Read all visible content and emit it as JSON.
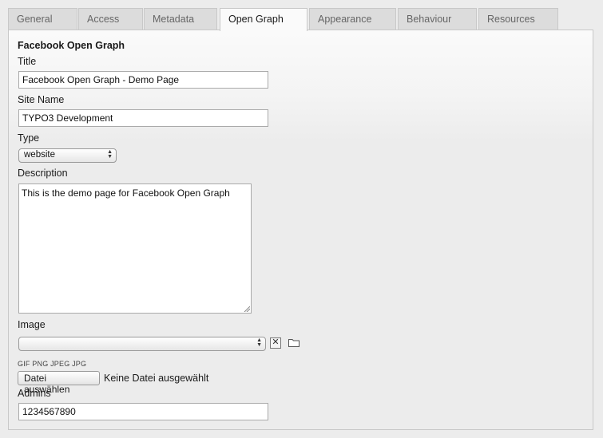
{
  "tabs": [
    "General",
    "Access",
    "Metadata",
    "Open Graph",
    "Appearance",
    "Behaviour",
    "Resources"
  ],
  "section_title": "Facebook Open Graph",
  "fields": {
    "title_label": "Title",
    "title_value": "Facebook Open Graph - Demo Page",
    "site_name_label": "Site Name",
    "site_name_value": "TYPO3 Development",
    "type_label": "Type",
    "type_value": "website",
    "description_label": "Description",
    "description_value": "This is the demo page for Facebook Open Graph",
    "image_label": "Image",
    "image_value": "",
    "file_types": "GIF PNG JPEG JPG",
    "choose_file_label": "Datei auswählen",
    "no_file_label": "Keine Datei ausgewählt",
    "admins_label": "Admins",
    "admins_value": "1234567890"
  },
  "icons": {
    "remove": "close-icon",
    "browse": "folder-icon"
  },
  "active_tab": "Open Graph"
}
